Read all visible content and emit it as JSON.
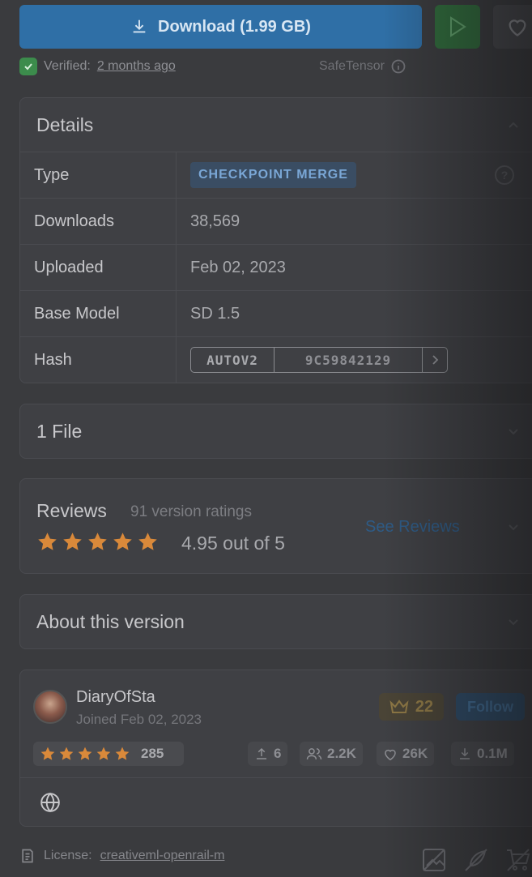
{
  "actions": {
    "download_label": "Download (1.99 GB)"
  },
  "verified": {
    "prefix": "Verified:",
    "when": "2 months ago",
    "format": "SafeTensor"
  },
  "details": {
    "title": "Details",
    "rows": [
      {
        "key": "Type",
        "value": "CHECKPOINT MERGE"
      },
      {
        "key": "Downloads",
        "value": "38,569"
      },
      {
        "key": "Uploaded",
        "value": "Feb 02, 2023"
      },
      {
        "key": "Base Model",
        "value": "SD 1.5"
      },
      {
        "key": "Hash",
        "algo": "AUTOV2",
        "value": "9C59842129"
      }
    ]
  },
  "files": {
    "title": "1 File"
  },
  "reviews": {
    "title": "Reviews",
    "count": "91 version ratings",
    "rating": 5,
    "score": "4.95 out of 5",
    "see_label": "See Reviews"
  },
  "about": {
    "title": "About this version"
  },
  "creator": {
    "name": "DiaryOfSta",
    "joined": "Joined Feb 02, 2023",
    "crown_count": "22",
    "follow_label": "Follow",
    "rating": 5,
    "rating_count": "285",
    "uploads": "6",
    "followers": "2.2K",
    "likes": "26K",
    "downloads": "0.1M"
  },
  "license": {
    "prefix": "License:",
    "name": "creativeml-openrail-m"
  },
  "colors": {
    "download_bg": "#2f6fa6",
    "play_bg": "#2f6b3b",
    "star": "#d9893a",
    "verified_shield": "#3c8c4c"
  }
}
